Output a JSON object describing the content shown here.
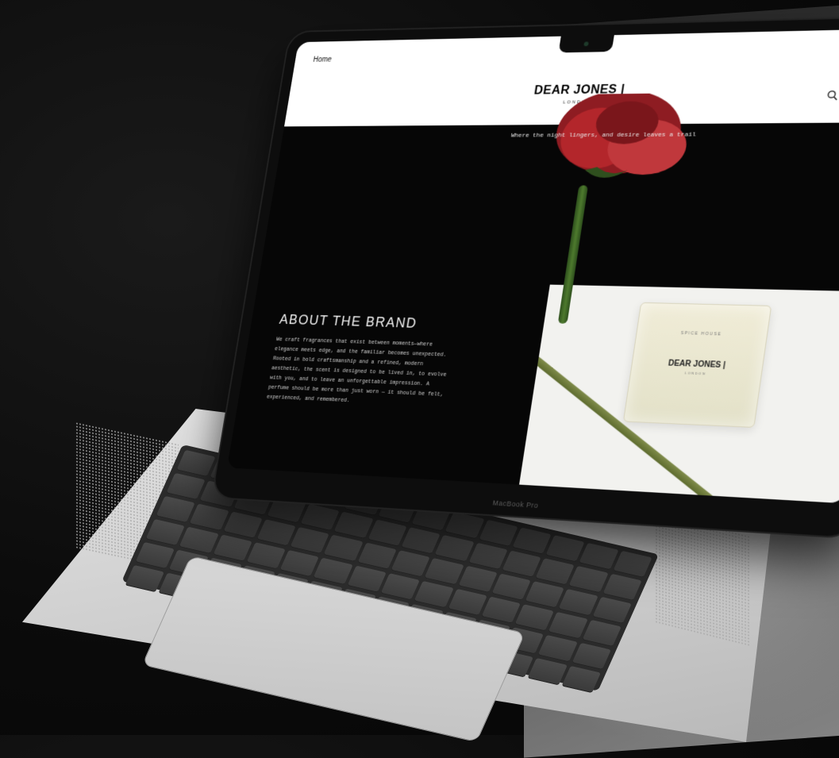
{
  "site": {
    "nav_home": "Home",
    "brand_name": "DEAR JONES |",
    "brand_location": "LONDON",
    "tagline": "Where the night lingers, and desire leaves a trail",
    "icons": [
      "search-icon",
      "account-icon",
      "bag-icon"
    ]
  },
  "about": {
    "title": "ABOUT THE BRAND",
    "body": "We craft fragrances that exist between moments—where elegance meets edge, and the familiar becomes unexpected. Rooted in bold craftsmanship and a refined, modern aesthetic, the scent is designed to be lived in, to evolve with you, and to leave an unforgettable impression. A perfume should be more than just worn — it should be felt, experienced, and remembered."
  },
  "product": {
    "label_top": "SPICE HOUSE",
    "brand": "DEAR JONES |",
    "location": "LONDON"
  },
  "device": {
    "model_label": "MacBook Pro"
  },
  "colors": {
    "header_bg": "#ffffff",
    "hero_bg": "#060606",
    "rose_red": "#b3262b",
    "stem_green": "#4e7a2e",
    "panel_bg": "#f2f2ef"
  }
}
